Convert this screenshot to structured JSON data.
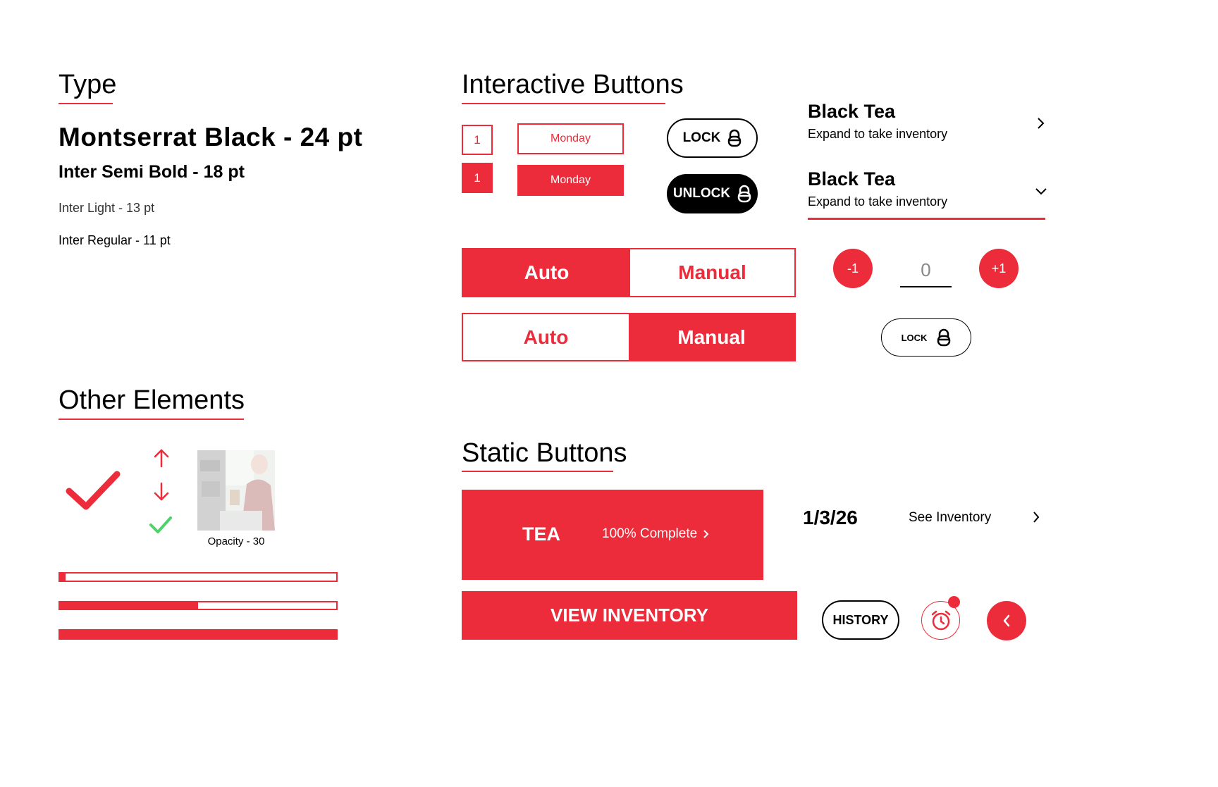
{
  "type_section": {
    "title": "Type",
    "samples": {
      "montserrat": "Montserrat Black - 24 pt",
      "semibold": "Inter Semi Bold - 18 pt",
      "light": "Inter Light - 13 pt",
      "regular": "Inter Regular - 11 pt"
    }
  },
  "other_section": {
    "title": "Other Elements",
    "photo_caption": "Opacity - 30",
    "progress_bars": [
      0.02,
      0.5,
      1.0
    ]
  },
  "interactive_section": {
    "title": "Interactive Buttons",
    "number_outline": "1",
    "number_filled": "1",
    "day_outline": "Monday",
    "day_filled": "Monday",
    "lock_label": "LOCK",
    "unlock_label": "UNLOCK",
    "toggle1": {
      "left": "Auto",
      "right": "Manual",
      "selected": "Auto"
    },
    "toggle2": {
      "left": "Auto",
      "right": "Manual",
      "selected": "Manual"
    },
    "accordion": [
      {
        "title": "Black Tea",
        "subtitle": "Expand to take inventory",
        "state": "collapsed"
      },
      {
        "title": "Black Tea",
        "subtitle": "Expand to take inventory",
        "state": "expanded"
      }
    ],
    "stepper": {
      "minus": "-1",
      "value": "0",
      "plus": "+1"
    },
    "small_lock_label": "LOCK"
  },
  "static_section": {
    "title": "Static Buttons",
    "tea_card": {
      "name": "TEA",
      "status": "100% Complete"
    },
    "date": "1/3/26",
    "see_inventory": "See Inventory",
    "view_inventory": "VIEW INVENTORY",
    "history": "HISTORY"
  },
  "colors": {
    "accent": "#ec2c3a",
    "success": "#4cd36a",
    "dark": "#000000"
  },
  "icons": [
    "checkmark-icon",
    "arrow-up-icon",
    "arrow-down-icon",
    "small-check-icon",
    "padlock-icon",
    "chevron-right-icon",
    "chevron-down-icon",
    "alarm-clock-icon",
    "back-chevron-icon"
  ]
}
